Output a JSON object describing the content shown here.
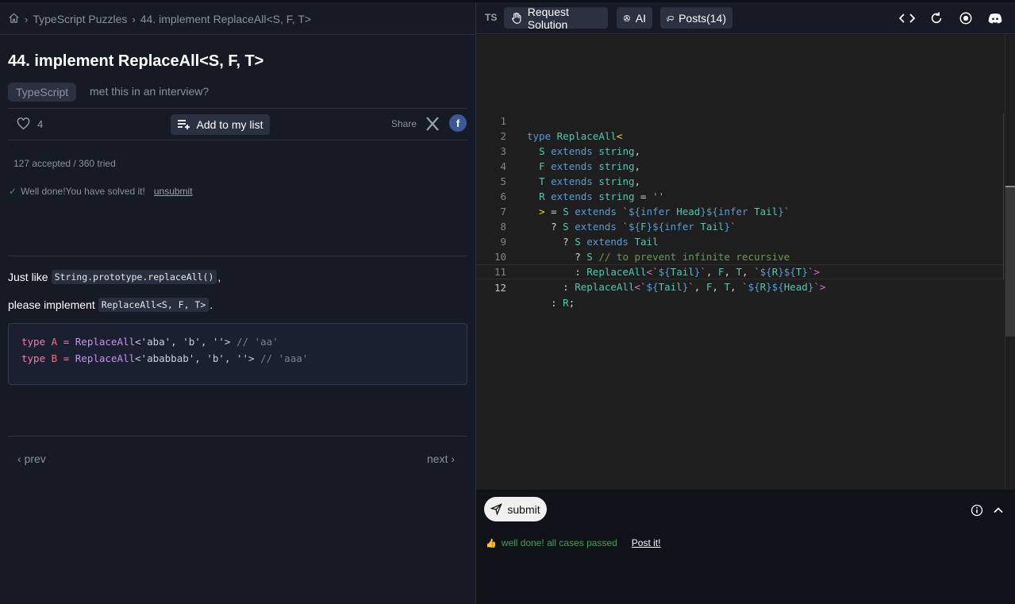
{
  "breadcrumb": {
    "home_icon": "home-icon",
    "items": [
      "TypeScript Puzzles",
      "44. implement ReplaceAll<S, F, T>"
    ]
  },
  "problem": {
    "title": "44. implement ReplaceAll<S, F, T>",
    "tag": "TypeScript",
    "met_question": "met this in an interview?",
    "likes": "4",
    "add_to_list": "Add to my list",
    "share_label": "Share",
    "facebook_glyph": "f",
    "stats": "127 accepted / 360 tried",
    "solved_text": "Well done!You have solved it!",
    "unsubmit": "unsubmit",
    "desc_line1_prefix": "Just like",
    "desc_line1_code": "String.prototype.replaceAll()",
    "desc_line1_suffix": ",",
    "desc_line2_prefix": "please implement",
    "desc_line2_code": "ReplaceAll<S, F, T>",
    "desc_line2_suffix": ".",
    "example": {
      "line1": {
        "kw": "type",
        "name": "A",
        "eq": "=",
        "fn": "ReplaceAll",
        "args": "<'aba', 'b', ''>",
        "comment": "// 'aa'"
      },
      "line2": {
        "kw": "type",
        "name": "B",
        "eq": "=",
        "fn": "ReplaceAll",
        "args": "<'ababbab', 'b', ''>",
        "comment": "// 'aaa'"
      }
    },
    "prev": "prev",
    "next": "next"
  },
  "toolbar": {
    "lang": "TS",
    "request_solution": "Request Solution",
    "ai": "AI",
    "posts": "Posts(14)",
    "icons": [
      "code-icon",
      "refresh-icon",
      "record-icon",
      "discord-icon"
    ]
  },
  "editor": {
    "line_numbers": [
      "1",
      "2",
      "3",
      "4",
      "5",
      "6",
      "7",
      "8",
      "9",
      "10",
      "11",
      "12"
    ],
    "current_line": 12
  },
  "bottom": {
    "submit": "submit",
    "result_message": "well done! all cases passed",
    "post_it": "Post it!"
  },
  "colors": {
    "accent_green": "#3aa64a",
    "bg": "#151a25",
    "editor_bg": "#1e1e1e"
  }
}
